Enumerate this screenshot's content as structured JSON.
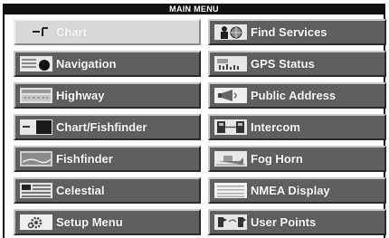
{
  "header": {
    "title": "MAIN MENU"
  },
  "menu": {
    "left": [
      {
        "label": "Chart",
        "icon": "chart-icon",
        "selected": true
      },
      {
        "label": "Navigation",
        "icon": "navigation-icon"
      },
      {
        "label": "Highway",
        "icon": "highway-icon"
      },
      {
        "label": "Chart/Fishfinder",
        "icon": "chart-fishfinder-icon"
      },
      {
        "label": "Fishfinder",
        "icon": "fishfinder-icon"
      },
      {
        "label": "Celestial",
        "icon": "celestial-icon"
      },
      {
        "label": "Setup Menu",
        "icon": "setup-gear-icon"
      }
    ],
    "right": [
      {
        "label": "Find Services",
        "icon": "find-services-icon"
      },
      {
        "label": "GPS Status",
        "icon": "gps-status-icon"
      },
      {
        "label": "Public Address",
        "icon": "megaphone-icon"
      },
      {
        "label": "Intercom",
        "icon": "intercom-icon"
      },
      {
        "label": "Fog Horn",
        "icon": "fog-horn-icon"
      },
      {
        "label": "NMEA Display",
        "icon": "nmea-display-icon"
      },
      {
        "label": "User Points",
        "icon": "user-points-icon"
      }
    ]
  }
}
